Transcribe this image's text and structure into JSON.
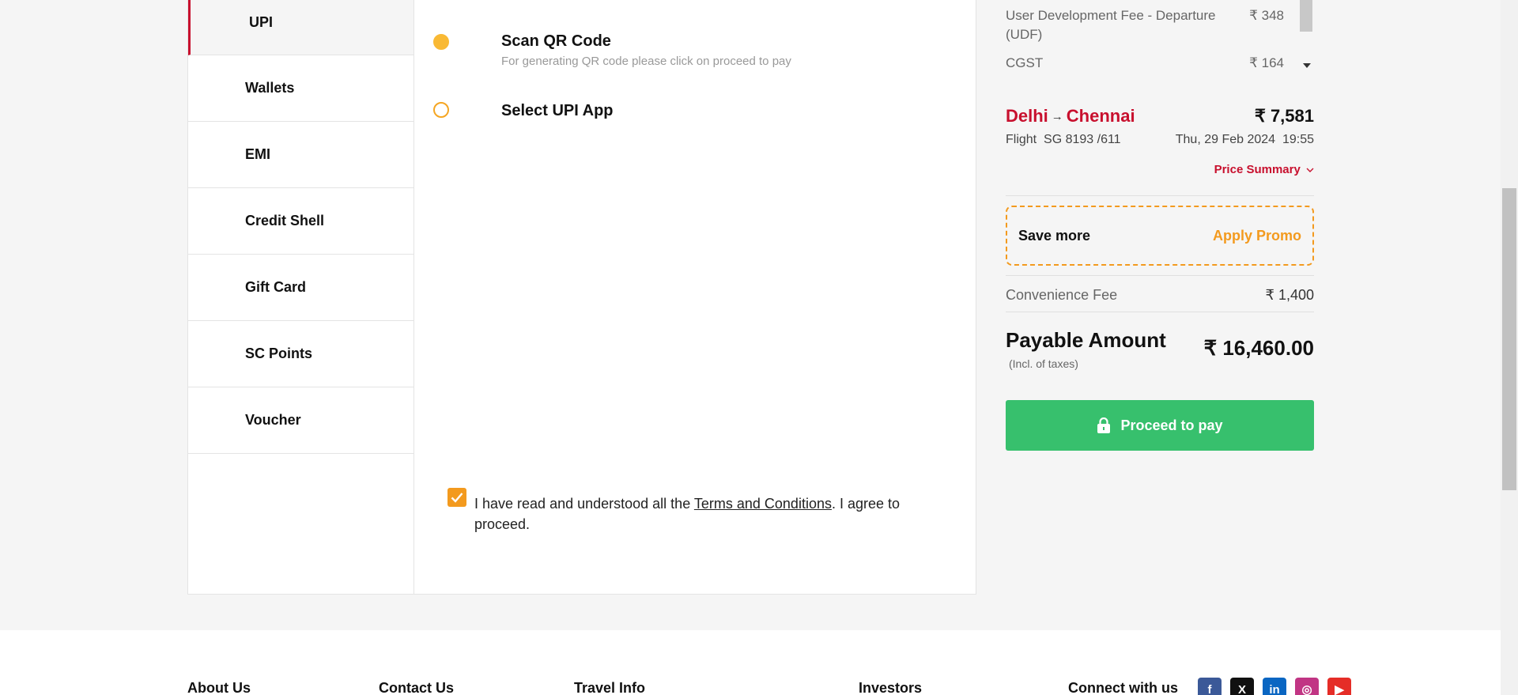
{
  "payment_menu": {
    "items": [
      {
        "label": "UPI",
        "active": true
      },
      {
        "label": "Wallets",
        "active": false
      },
      {
        "label": "EMI",
        "active": false
      },
      {
        "label": "Credit Shell",
        "active": false
      },
      {
        "label": "Gift Card",
        "active": false
      },
      {
        "label": "SC Points",
        "active": false
      },
      {
        "label": "Voucher",
        "active": false
      }
    ]
  },
  "upi": {
    "options": [
      {
        "title": "Scan QR Code",
        "subtitle": "For generating QR code please click on proceed to pay",
        "selected": true
      },
      {
        "title": "Select UPI App",
        "subtitle": "",
        "selected": false
      }
    ]
  },
  "terms": {
    "checked": true,
    "before": "I have read and understood all the ",
    "link": "Terms and Conditions",
    "after": ". I agree to proceed."
  },
  "summary": {
    "fees": [
      {
        "label": "User Development Fee - Departure (UDF)",
        "amount": "₹ 348"
      },
      {
        "label": "CGST",
        "amount": "₹ 164"
      }
    ],
    "from": "Delhi",
    "to": "Chennai",
    "route_arrow": "→",
    "fare": "₹ 7,581",
    "flight_label": "Flight",
    "flight_number": "SG 8193 /611",
    "datetime": "Thu, 29 Feb 2024  19:55",
    "price_summary": "Price Summary",
    "promo_label": "Save more",
    "promo_link": "Apply Promo",
    "convenience_label": "Convenience Fee",
    "convenience_amount": "₹ 1,400",
    "payable_label": "Payable Amount",
    "payable_note": "(Incl. of taxes)",
    "payable_amount": "₹ 16,460.00",
    "proceed_label": "Proceed to pay"
  },
  "footer": {
    "links": [
      "About Us",
      "Contact Us",
      "Travel Info",
      "Investors"
    ],
    "connect_label": "Connect with us",
    "socials": [
      {
        "name": "facebook-icon",
        "glyph": "f",
        "color": "#3b5998"
      },
      {
        "name": "x-icon",
        "glyph": "X",
        "color": "#111111"
      },
      {
        "name": "linkedin-icon",
        "glyph": "in",
        "color": "#0a66c2"
      },
      {
        "name": "instagram-icon",
        "glyph": "◎",
        "color": "#c13584"
      },
      {
        "name": "youtube-icon",
        "glyph": "▶",
        "color": "#e52d27"
      }
    ]
  },
  "colors": {
    "brand_red": "#c8102e",
    "accent_orange": "#f39a1e",
    "proceed_green": "#37c06d"
  }
}
